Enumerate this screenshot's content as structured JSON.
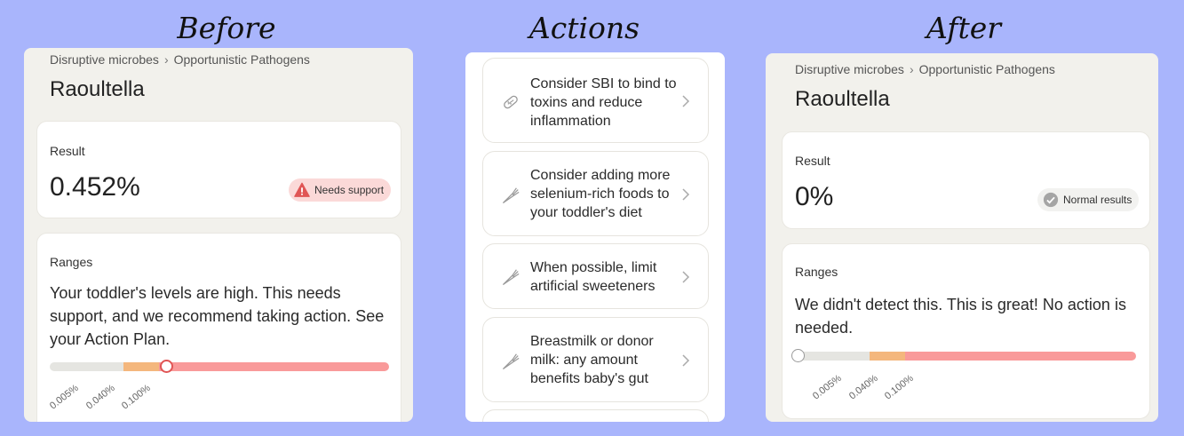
{
  "titles": {
    "before": "Before",
    "actions": "Actions",
    "after": "After"
  },
  "before": {
    "breadcrumb": {
      "parent": "Disruptive microbes",
      "child": "Opportunistic Pathogens"
    },
    "name": "Raoultella",
    "result_label": "Result",
    "result_value": "0.452%",
    "status_badge": "Needs support",
    "ranges_label": "Ranges",
    "ranges_text": "Your toddler's levels are high. This needs support, and we recommend taking action. See your Action Plan.",
    "ticks": [
      "0.005%",
      "0.040%",
      "0.100%"
    ]
  },
  "actions": [
    {
      "text": "Consider SBI to bind to toxins and reduce inflammation",
      "icon": "pill-icon"
    },
    {
      "text": "Consider adding more selenium-rich foods to your toddler's diet",
      "icon": "carrot-icon"
    },
    {
      "text": "When possible, limit artificial sweeteners",
      "icon": "carrot-icon"
    },
    {
      "text": "Breastmilk or donor milk: any amount benefits baby's gut",
      "icon": "carrot-icon"
    }
  ],
  "after": {
    "breadcrumb": {
      "parent": "Disruptive microbes",
      "child": "Opportunistic Pathogens"
    },
    "name": "Raoultella",
    "result_label": "Result",
    "result_value": "0%",
    "status_badge": "Normal results",
    "ranges_label": "Ranges",
    "ranges_text": "We didn't detect this. This is great! No action is needed.",
    "ticks": [
      "0.005%",
      "0.040%",
      "0.100%"
    ]
  },
  "colors": {
    "background": "#a9b5fc",
    "normal": "#e5e5e1",
    "borderline": "#f4b77d",
    "high": "#f99a9a",
    "alert": "#e05555",
    "ok_check": "#a5a5a5"
  }
}
